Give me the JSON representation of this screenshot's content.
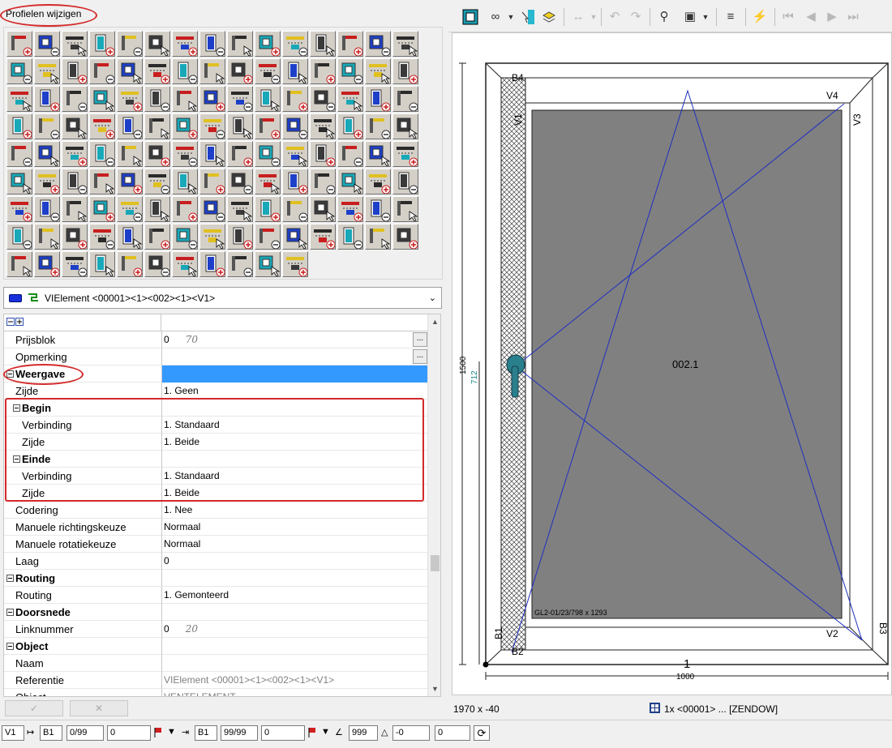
{
  "panel_title": "Profielen wijzigen",
  "element_selector": {
    "value": "VIElement <00001><1><002><1><V1>"
  },
  "grid": {
    "rows": [
      {
        "label": "Prijsblok",
        "value": "0",
        "note": "70",
        "kind": "prop",
        "ellipsis": true
      },
      {
        "label": "Opmerking",
        "value": "",
        "kind": "prop",
        "ellipsis": true
      },
      {
        "label": "Weergave",
        "value": "",
        "kind": "cat",
        "selected": true
      },
      {
        "label": "Zijde",
        "value": "1. Geen",
        "kind": "prop"
      },
      {
        "label": "Begin",
        "value": "",
        "kind": "subcat"
      },
      {
        "label": "Verbinding",
        "value": "1. Standaard",
        "kind": "indent"
      },
      {
        "label": "Zijde",
        "value": "1. Beide",
        "kind": "indent"
      },
      {
        "label": "Einde",
        "value": "",
        "kind": "subcat"
      },
      {
        "label": "Verbinding",
        "value": "1. Standaard",
        "kind": "indent"
      },
      {
        "label": "Zijde",
        "value": "1. Beide",
        "kind": "indent"
      },
      {
        "label": "Codering",
        "value": "1. Nee",
        "kind": "prop"
      },
      {
        "label": "Manuele richtingskeuze",
        "value": "Normaal",
        "kind": "prop"
      },
      {
        "label": "Manuele rotatiekeuze",
        "value": "Normaal",
        "kind": "prop"
      },
      {
        "label": "Laag",
        "value": "0",
        "kind": "prop"
      },
      {
        "label": "Routing",
        "value": "",
        "kind": "cat"
      },
      {
        "label": "Routing",
        "value": "1. Gemonteerd",
        "kind": "prop"
      },
      {
        "label": "Doorsnede",
        "value": "",
        "kind": "cat"
      },
      {
        "label": "Linknummer",
        "value": "0",
        "note": "20",
        "kind": "prop"
      },
      {
        "label": "Object",
        "value": "",
        "kind": "cat"
      },
      {
        "label": "Naam",
        "value": "",
        "kind": "prop"
      },
      {
        "label": "Referentie",
        "value": "VIElement <00001><1><002><1><V1>",
        "kind": "prop",
        "grey": true
      },
      {
        "label": "Object",
        "value": "VENTELEMENT",
        "kind": "prop",
        "grey": true
      }
    ]
  },
  "drawing": {
    "labels": {
      "b4": "B4",
      "v1": "V1",
      "v4": "V4",
      "v3": "V3",
      "b1": "B1",
      "b2": "B2",
      "v2": "V2",
      "b3": "B3",
      "center": "002.1",
      "glass": "GL2-01/23/798 x 1293",
      "height": "1500",
      "handle_height": "712",
      "width": "1000",
      "position": "1"
    }
  },
  "status_right": {
    "coords": "1970 x -40",
    "summary": "1x <00001> ... [ZENDOW]"
  },
  "bottom_bar": {
    "f1": "V1",
    "f2": "B1",
    "f3": "0/99",
    "f4": "0",
    "f5": "B1",
    "f6": "99/99",
    "f7": "0",
    "f8": "999",
    "f9": "-0",
    "f10": "0"
  }
}
